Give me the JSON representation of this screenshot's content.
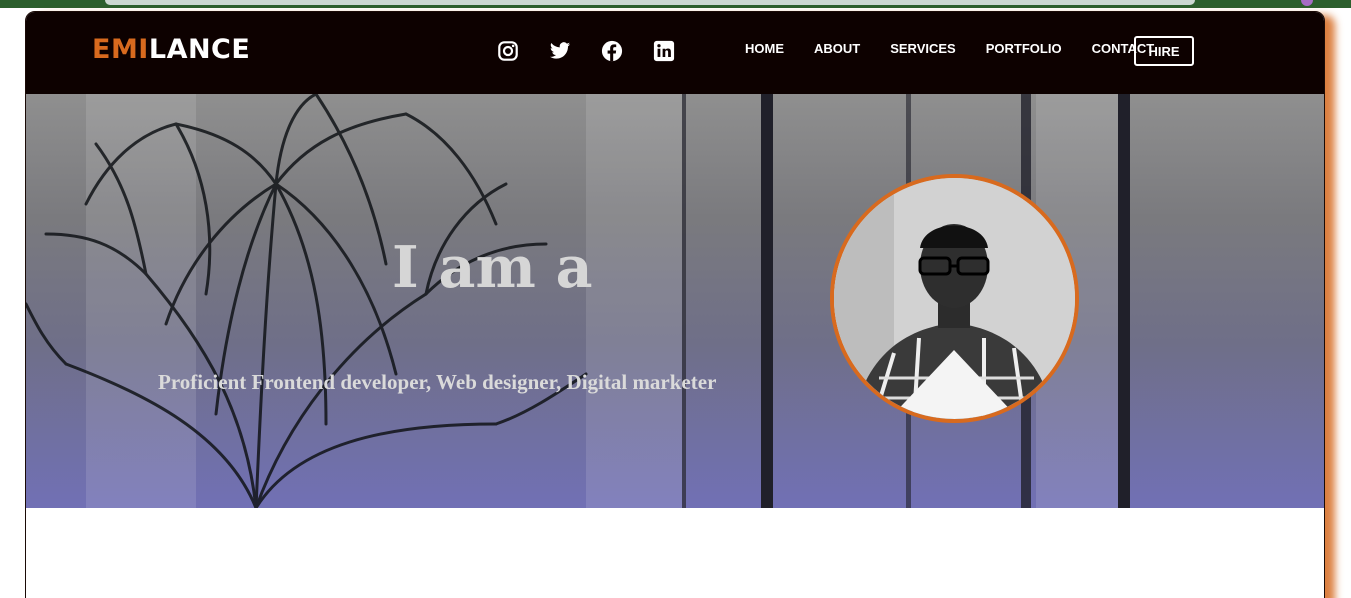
{
  "brand": {
    "part1": "EMI",
    "part2": "LANCE",
    "accent_color": "#d86a1e"
  },
  "socials": [
    {
      "icon": "instagram-icon"
    },
    {
      "icon": "twitter-icon"
    },
    {
      "icon": "facebook-icon"
    },
    {
      "icon": "linkedin-icon"
    }
  ],
  "nav": {
    "items": [
      "HOME",
      "ABOUT",
      "SERVICES",
      "PORTFOLIO",
      "CONTACT"
    ],
    "hire_label": "HIRE"
  },
  "hero": {
    "title": "I am a",
    "subtitle": "Proficient Frontend developer, Web designer, Digital marketer",
    "avatar_border_color": "#d86a1e"
  },
  "colors": {
    "navbar_bg": "#0d0100",
    "frame_shadow": "#d66a20"
  }
}
